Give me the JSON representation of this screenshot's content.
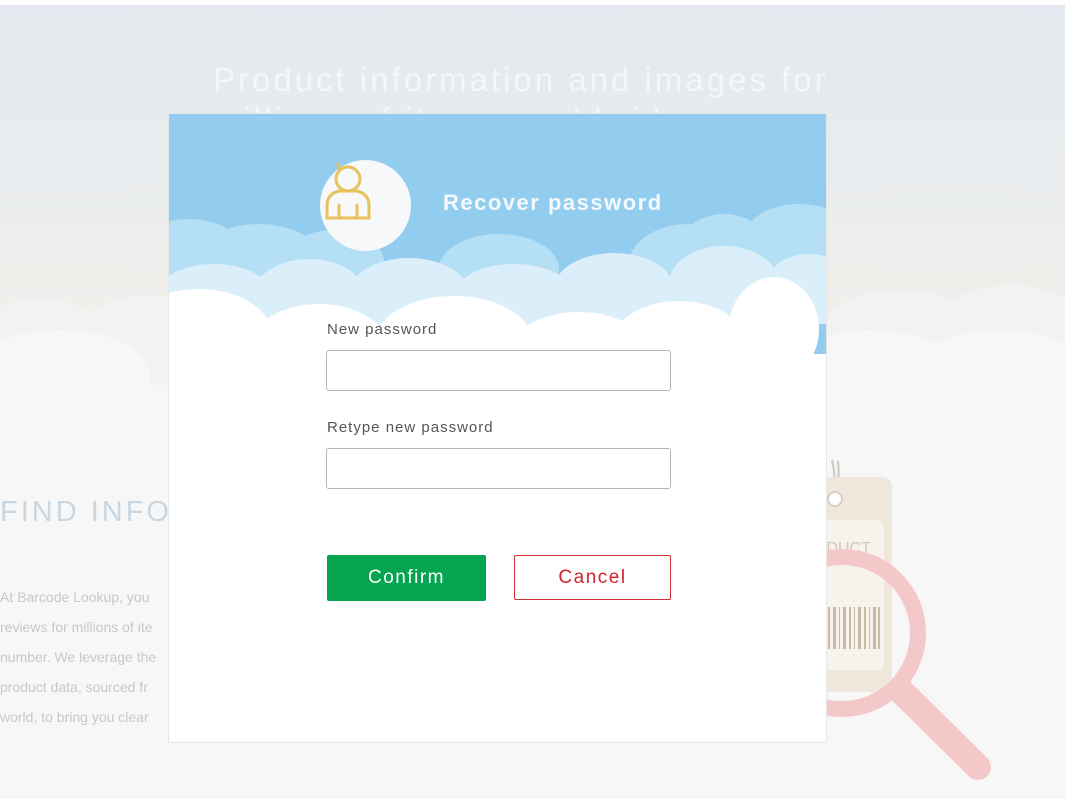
{
  "background": {
    "hero_title": "Product information and images for millions of items worldwide",
    "section_heading": "FIND INFO",
    "section_text_lines": [
      "At Barcode Lookup, you",
      "reviews for millions of ite",
      "number. We leverage the",
      "product data, sourced fr",
      "world, to bring you clear"
    ],
    "product_tag_text": "ODUCT"
  },
  "modal": {
    "title": "Recover password",
    "avatar_icon": "user-icon",
    "fields": {
      "new_password": {
        "label": "New password",
        "value": "",
        "placeholder": ""
      },
      "retype_password": {
        "label": "Retype new password",
        "value": "",
        "placeholder": ""
      }
    },
    "buttons": {
      "confirm": "Confirm",
      "cancel": "Cancel"
    }
  },
  "colors": {
    "header_blue": "#92cdef",
    "confirm_green": "#05a550",
    "cancel_red": "#d2232a",
    "avatar_gold": "#e8c25a"
  }
}
